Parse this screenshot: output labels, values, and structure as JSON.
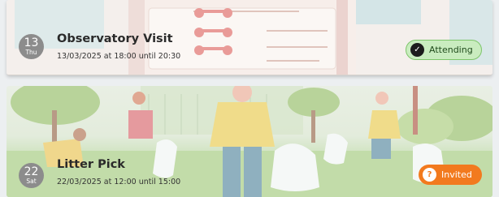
{
  "events": [
    {
      "day": "13",
      "weekday": "Thu",
      "title": "Observatory Visit",
      "time": "13/03/2025 at 18:00 until 20:30",
      "status": "Attending",
      "status_icon": "check-icon",
      "status_symbol": "✓",
      "status_color": "#c9ecbf"
    },
    {
      "day": "22",
      "weekday": "Sat",
      "title": "Litter Pick",
      "time": "22/03/2025 at 12:00 until 15:00",
      "status": "Invited",
      "status_icon": "question-icon",
      "status_symbol": "?",
      "status_color": "#f27a1e"
    }
  ]
}
